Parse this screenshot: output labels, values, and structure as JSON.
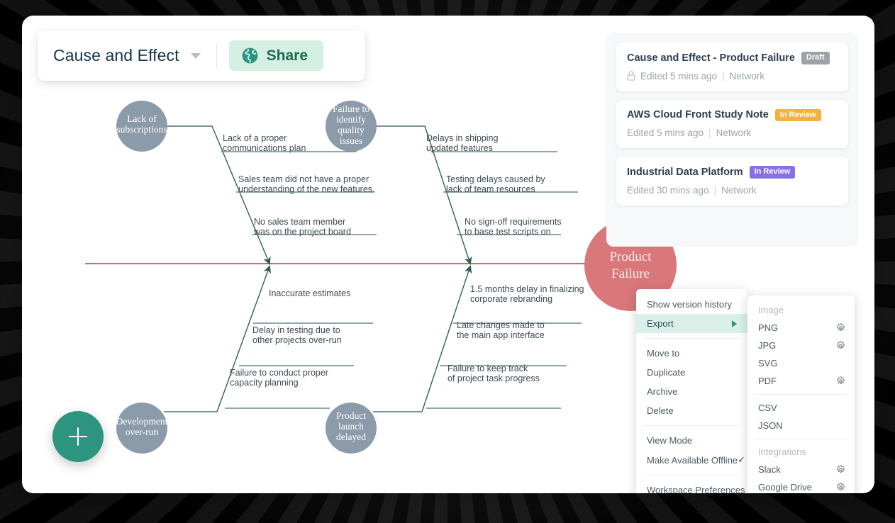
{
  "toolbar": {
    "doc_title": "Cause and Effect",
    "caret_icon": "chevron-down-icon",
    "share_label": "Share",
    "share_icon": "globe-icon",
    "share_bg": "#d3f0e3",
    "share_fg": "#1d6a55"
  },
  "fab": {
    "icon": "plus-icon",
    "color": "#2d9480"
  },
  "diagram": {
    "type": "fishbone",
    "spine_color": "#a94442",
    "branch_color": "#3d6b66",
    "bubble_color": "#8b9baa",
    "head_color": "#d9777a",
    "head": "Product\nFailure",
    "categories": [
      {
        "name": "Lack of subscriptions",
        "label": "Lack of\nsubscriptions",
        "position": "top-left",
        "causes": [
          "Lack of a proper\ncommunications plan",
          "Sales team did not have a proper\nunderstanding of the new features.",
          "No sales team member\nwas on the project board"
        ]
      },
      {
        "name": "Failure to identify quality issues",
        "label": "Failure to\nidentify\nquality\nissues",
        "position": "top-right",
        "causes": [
          "Delays in shipping\nupdated features",
          "Testing delays caused by\nlack of team resources",
          "No sign-off requirements\nto base test scripts on"
        ]
      },
      {
        "name": "Development over-run",
        "label": "Development\nover-run",
        "position": "bottom-left",
        "causes": [
          "Inaccurate estimates",
          "Delay in testing due to\nother projects over-run",
          "Failure to conduct proper\ncapacity planning"
        ]
      },
      {
        "name": "Product launch delayed",
        "label": "Product\nlaunch\ndelayed",
        "position": "bottom-right",
        "causes": [
          "1.5 months delay in finalizing\ncorporate rebranding",
          "Late changes made to\nthe main app interface",
          "Failure to keep track\nof project task progress"
        ]
      }
    ]
  },
  "docs_panel": {
    "cards": [
      {
        "title": "Cause and Effect - Product Failure",
        "badge": "Draft",
        "badge_color": "#9ba3a8",
        "lock_icon": "lock-icon",
        "edited": "Edited 5 mins ago",
        "separator": "|",
        "scope": "Network"
      },
      {
        "title": "AWS Cloud Front Study Note",
        "badge": "In Review",
        "badge_color": "#f5b041",
        "lock_icon": "",
        "edited": "Edited 5 mins ago",
        "separator": "|",
        "scope": "Network"
      },
      {
        "title": "Industrial Data Platform",
        "badge": "In Review",
        "badge_color": "#8b6fe8",
        "lock_icon": "",
        "edited": "Edited 30 mins ago",
        "separator": "|",
        "scope": "Network"
      }
    ]
  },
  "context_menu": {
    "items": [
      {
        "label": "Show version history",
        "type": "item"
      },
      {
        "label": "Export",
        "type": "item",
        "active": true,
        "submenu_icon": "triangle-right-icon"
      },
      {
        "type": "separator"
      },
      {
        "label": "Move to",
        "type": "item"
      },
      {
        "label": "Duplicate",
        "type": "item"
      },
      {
        "label": "Archive",
        "type": "item"
      },
      {
        "label": "Delete",
        "type": "item"
      },
      {
        "type": "separator"
      },
      {
        "label": "View Mode",
        "type": "item"
      },
      {
        "label": "Make Available Offline",
        "type": "item",
        "check": "✓"
      },
      {
        "type": "separator"
      },
      {
        "label": "Workspace Preferences",
        "type": "item"
      }
    ]
  },
  "export_menu": {
    "groups": [
      {
        "header": "Image",
        "items": [
          {
            "label": "PNG",
            "gear": true
          },
          {
            "label": "JPG",
            "gear": true
          },
          {
            "label": "SVG",
            "gear": false
          },
          {
            "label": "PDF",
            "gear": true
          }
        ]
      },
      {
        "header": "",
        "items": [
          {
            "label": "CSV",
            "gear": false
          },
          {
            "label": "JSON",
            "gear": false
          }
        ]
      },
      {
        "header": "Integrations",
        "items": [
          {
            "label": "Slack",
            "gear": true
          },
          {
            "label": "Google Drive",
            "gear": true
          }
        ]
      }
    ]
  }
}
